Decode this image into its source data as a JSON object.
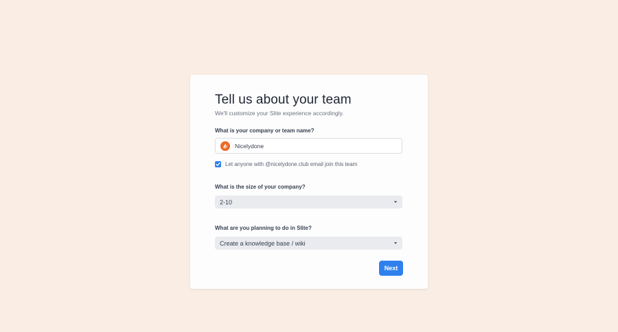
{
  "form": {
    "title": "Tell us about your team",
    "subtitle": "We'll customize your Slite experience accordingly.",
    "company_question": "What is your company or team name?",
    "company_name": "Nicelydone",
    "team_logo_icon": "paint-swatch-icon",
    "join_checkbox_checked": true,
    "join_checkbox_label": "Let anyone with @nicelydone.club email join this team",
    "size_question": "What is the size of your company?",
    "size_value": "2-10",
    "plan_question": "What are you planning to do in Slite?",
    "plan_value": "Create a knowledge base / wiki",
    "next_label": "Next"
  },
  "colors": {
    "background": "#f9ede4",
    "accent": "#2f80ed",
    "logo": "#ee6a2b"
  }
}
